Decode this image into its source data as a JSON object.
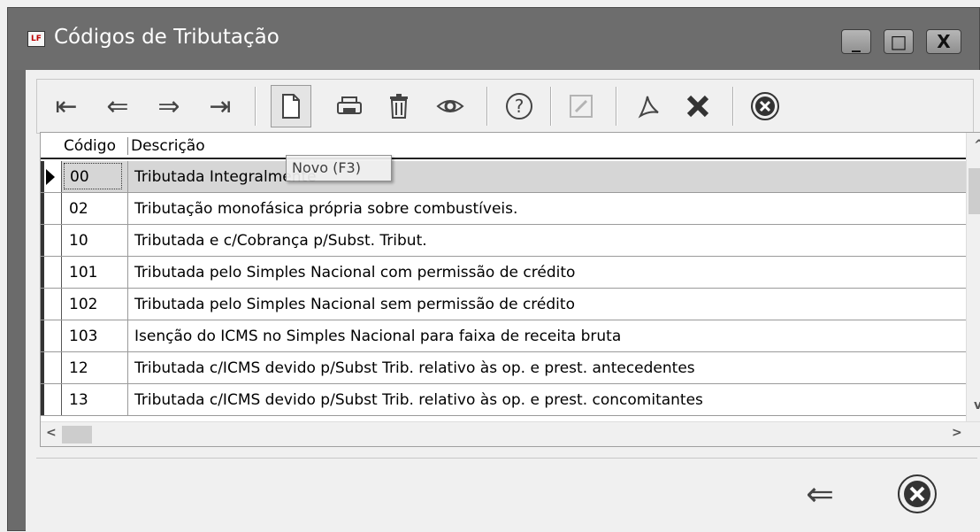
{
  "window": {
    "title": "Códigos de Tributação",
    "app_icon_text": "LF",
    "min_glyph": "_",
    "max_glyph": "□",
    "close_glyph": "X"
  },
  "toolbar": {
    "buttons": [
      {
        "name": "first-record",
        "icon": "first-arrow-icon",
        "glyph": "⇤"
      },
      {
        "name": "prior-record",
        "icon": "left-arrow-icon",
        "glyph": "⇐"
      },
      {
        "name": "next-record",
        "icon": "right-arrow-icon",
        "glyph": "⇒"
      },
      {
        "name": "last-record",
        "icon": "last-arrow-icon",
        "glyph": "⇥"
      },
      {
        "name": "new",
        "icon": "new-document-icon",
        "pressed": true
      },
      {
        "name": "print",
        "icon": "printer-icon"
      },
      {
        "name": "delete",
        "icon": "trash-icon"
      },
      {
        "name": "view",
        "icon": "eye-icon"
      },
      {
        "name": "help",
        "icon": "help-icon"
      },
      {
        "name": "edit",
        "icon": "edit-icon",
        "disabled": true
      },
      {
        "name": "pdf",
        "icon": "pdf-icon"
      },
      {
        "name": "excel",
        "icon": "excel-icon"
      },
      {
        "name": "close",
        "icon": "close-circle-icon"
      }
    ],
    "tooltip": "Novo (F3)"
  },
  "grid": {
    "columns": [
      "Código",
      "Descrição"
    ],
    "selected_index": 0,
    "rows": [
      {
        "code": "00",
        "description": "Tributada Integralmente"
      },
      {
        "code": "02",
        "description": "Tributação monofásica própria sobre combustíveis."
      },
      {
        "code": "10",
        "description": "Tributada e c/Cobrança p/Subst. Tribut."
      },
      {
        "code": "101",
        "description": "Tributada pelo Simples Nacional com permissão de crédito"
      },
      {
        "code": "102",
        "description": "Tributada pelo Simples Nacional sem permissão de crédito"
      },
      {
        "code": "103",
        "description": "Isenção do ICMS no Simples Nacional para faixa de receita bruta"
      },
      {
        "code": "12",
        "description": "Tributada c/ICMS devido p/Subst Trib. relativo às op. e prest. antecedentes"
      },
      {
        "code": "13",
        "description": "Tributada c/ICMS devido p/Subst Trib. relativo às op. e prest. concomitantes"
      }
    ]
  },
  "footer": {
    "back_glyph": "⇐",
    "back_icon": "back-arrow-icon",
    "close_icon": "close-circle-icon"
  }
}
